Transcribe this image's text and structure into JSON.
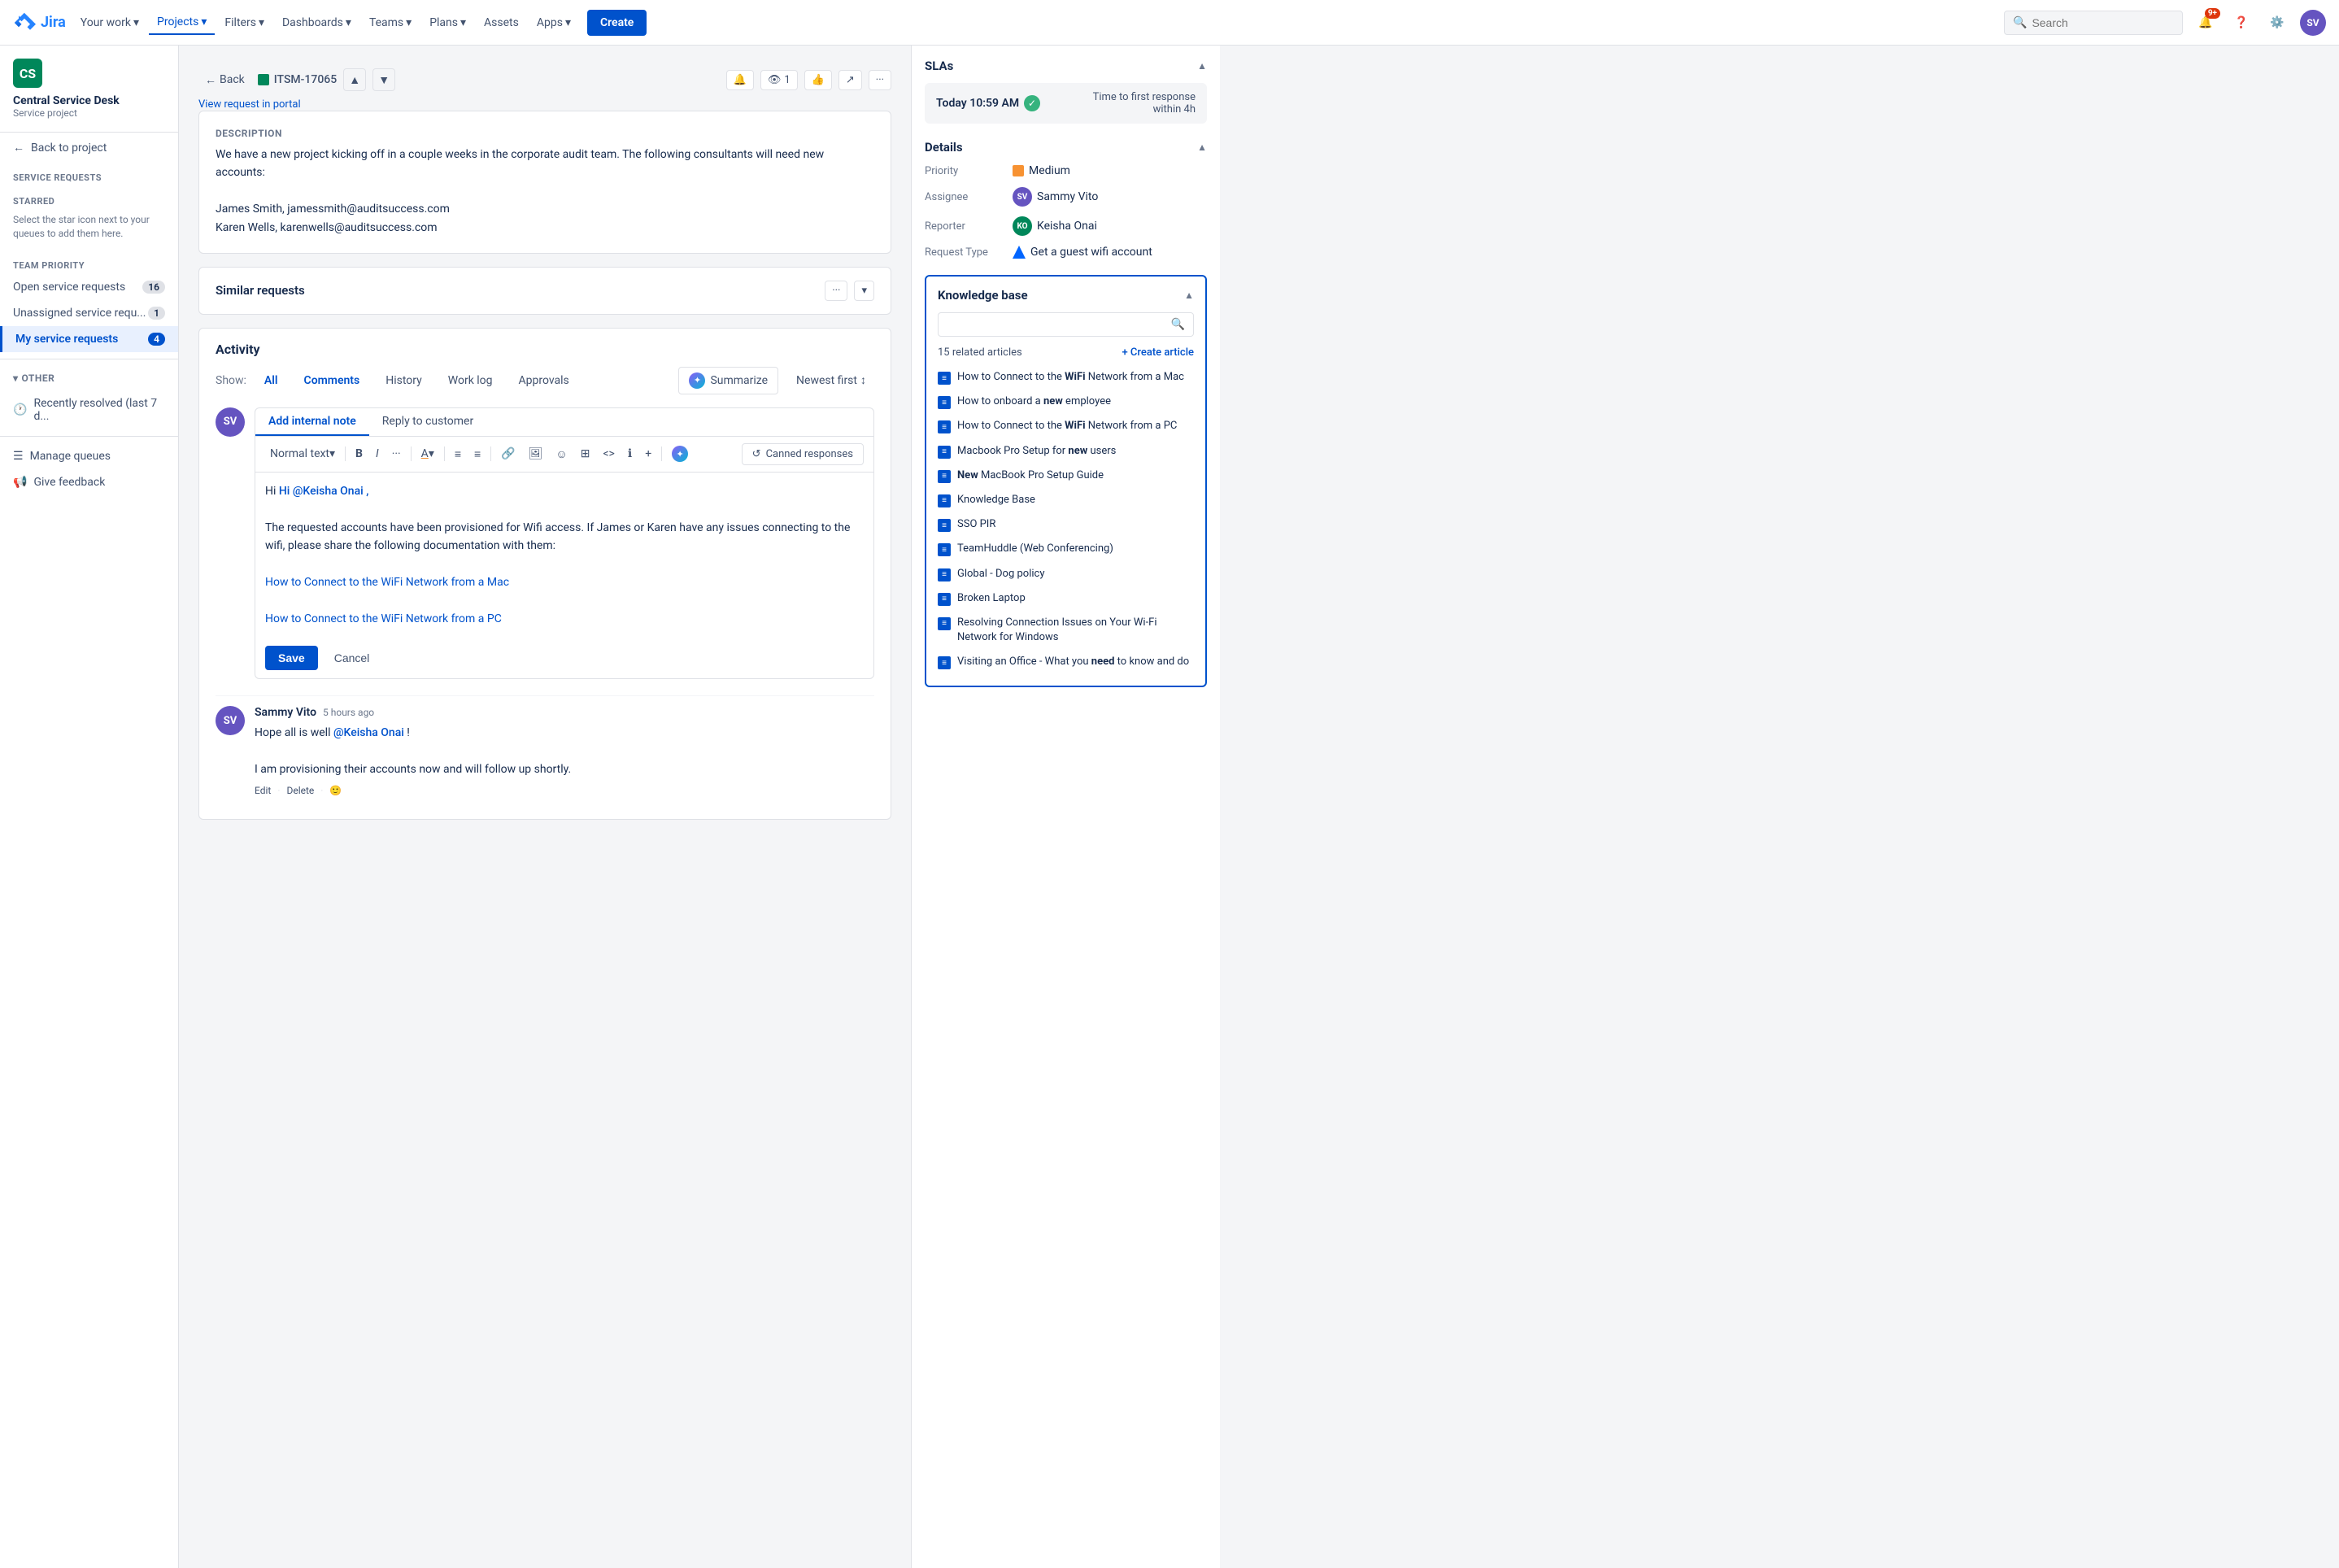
{
  "nav": {
    "logo_text": "Jira",
    "items": [
      "Your work",
      "Projects",
      "Filters",
      "Dashboards",
      "Teams",
      "Plans",
      "Assets",
      "Apps"
    ],
    "active_item": "Projects",
    "create_label": "Create",
    "search_placeholder": "Search",
    "notification_count": "9+"
  },
  "sidebar": {
    "project_name": "Central Service Desk",
    "project_type": "Service project",
    "back_label": "Back to project",
    "service_requests_label": "Service requests",
    "starred_label": "STARRED",
    "starred_note": "Select the star icon next to your queues to add them here.",
    "team_priority_label": "TEAM PRIORITY",
    "queue_items": [
      {
        "label": "Open service requests",
        "count": "16"
      },
      {
        "label": "Unassigned service requ...",
        "count": "1"
      },
      {
        "label": "My service requests",
        "count": "4",
        "active": true
      }
    ],
    "other_label": "OTHER",
    "other_items": [
      {
        "label": "Recently resolved (last 7 d...",
        "icon": "clock"
      }
    ],
    "manage_queues_label": "Manage queues",
    "give_feedback_label": "Give feedback"
  },
  "issue": {
    "back_label": "Back",
    "issue_key": "ITSM-17065",
    "view_portal_label": "View request in portal",
    "description_label": "Description",
    "description_text": "We have a new project kicking off in a couple weeks in the corporate audit team. The following consultants will need new accounts:",
    "consultants": [
      "James Smith, jamessmith@auditsuccess.com",
      "Karen Wells, karenwells@auditsuccess.com"
    ],
    "similar_requests_label": "Similar requests",
    "activity_label": "Activity",
    "show_label": "Show:",
    "filter_all": "All",
    "filter_comments": "Comments",
    "filter_history": "History",
    "filter_worklog": "Work log",
    "filter_approvals": "Approvals",
    "summarize_label": "Summarize",
    "sort_label": "Newest first",
    "add_internal_note_tab": "Add internal note",
    "reply_to_customer_tab": "Reply to customer",
    "toolbar": {
      "text_style": "Normal text",
      "bold": "B",
      "italic": "I",
      "more": "···",
      "text_color": "A",
      "bullet_list": "≡",
      "numbered_list": "≡",
      "link": "🔗",
      "image": "🖼",
      "emoji": "☺",
      "table": "⊞",
      "code": "<>",
      "info": "ℹ",
      "plus": "+",
      "ai": "✦",
      "canned_responses": "Canned responses"
    },
    "editor_content": {
      "greeting": "Hi @Keisha Onai ,",
      "body1": "The requested accounts have been provisioned for Wifi access. If James or Karen have any issues connecting to the wifi, please share the following documentation with them:",
      "link1": "How to Connect to the WiFi Network from a Mac",
      "link2": "How to Connect to the WiFi Network from a PC"
    },
    "save_label": "Save",
    "cancel_label": "Cancel",
    "comments": [
      {
        "author": "Sammy Vito",
        "time": "5 hours ago",
        "avatar_initials": "SV",
        "body1": "Hope all is well @Keisha Onai !",
        "body2": "I am provisioning their accounts now and will follow up shortly.",
        "actions": [
          "Edit",
          "Delete"
        ]
      }
    ]
  },
  "right_panel": {
    "sla_title": "SLAs",
    "sla_items": [
      {
        "time": "Today 10:59 AM",
        "met": true,
        "description": "Time to first response\nwithin 4h"
      }
    ],
    "details_title": "Details",
    "priority_label": "Priority",
    "priority_value": "Medium",
    "assignee_label": "Assignee",
    "assignee_name": "Sammy Vito",
    "reporter_label": "Reporter",
    "reporter_name": "Keisha Onai",
    "request_type_label": "Request Type",
    "request_type_value": "Get a guest wifi account",
    "kb_title": "Knowledge base",
    "kb_search_placeholder": "",
    "kb_count": "15 related articles",
    "kb_create_label": "+ Create article",
    "kb_articles": [
      {
        "title": "How to Connect to the ",
        "highlight": "WiFi",
        "rest": " Network from a Mac"
      },
      {
        "title": "How to onboard a ",
        "highlight": "new",
        "rest": " employee"
      },
      {
        "title": "How to Connect to the ",
        "highlight": "WiFi",
        "rest": " Network from a PC"
      },
      {
        "title": "Macbook Pro Setup for ",
        "highlight": "new",
        "rest": " users"
      },
      {
        "title": "",
        "highlight": "New",
        "rest": " MacBook Pro Setup Guide"
      },
      {
        "title": "Knowledge Base",
        "highlight": "",
        "rest": ""
      },
      {
        "title": "SSO PIR",
        "highlight": "",
        "rest": ""
      },
      {
        "title": "TeamHuddle (Web Conferencing)",
        "highlight": "",
        "rest": ""
      },
      {
        "title": "Global - Dog policy",
        "highlight": "",
        "rest": ""
      },
      {
        "title": "Broken Laptop",
        "highlight": "",
        "rest": ""
      },
      {
        "title": "Resolving Connection Issues on Your Wi-Fi Network for Windows",
        "highlight": "",
        "rest": ""
      },
      {
        "title": "Visiting an Office - What you ",
        "highlight": "need",
        "rest": " to know and do"
      }
    ]
  }
}
